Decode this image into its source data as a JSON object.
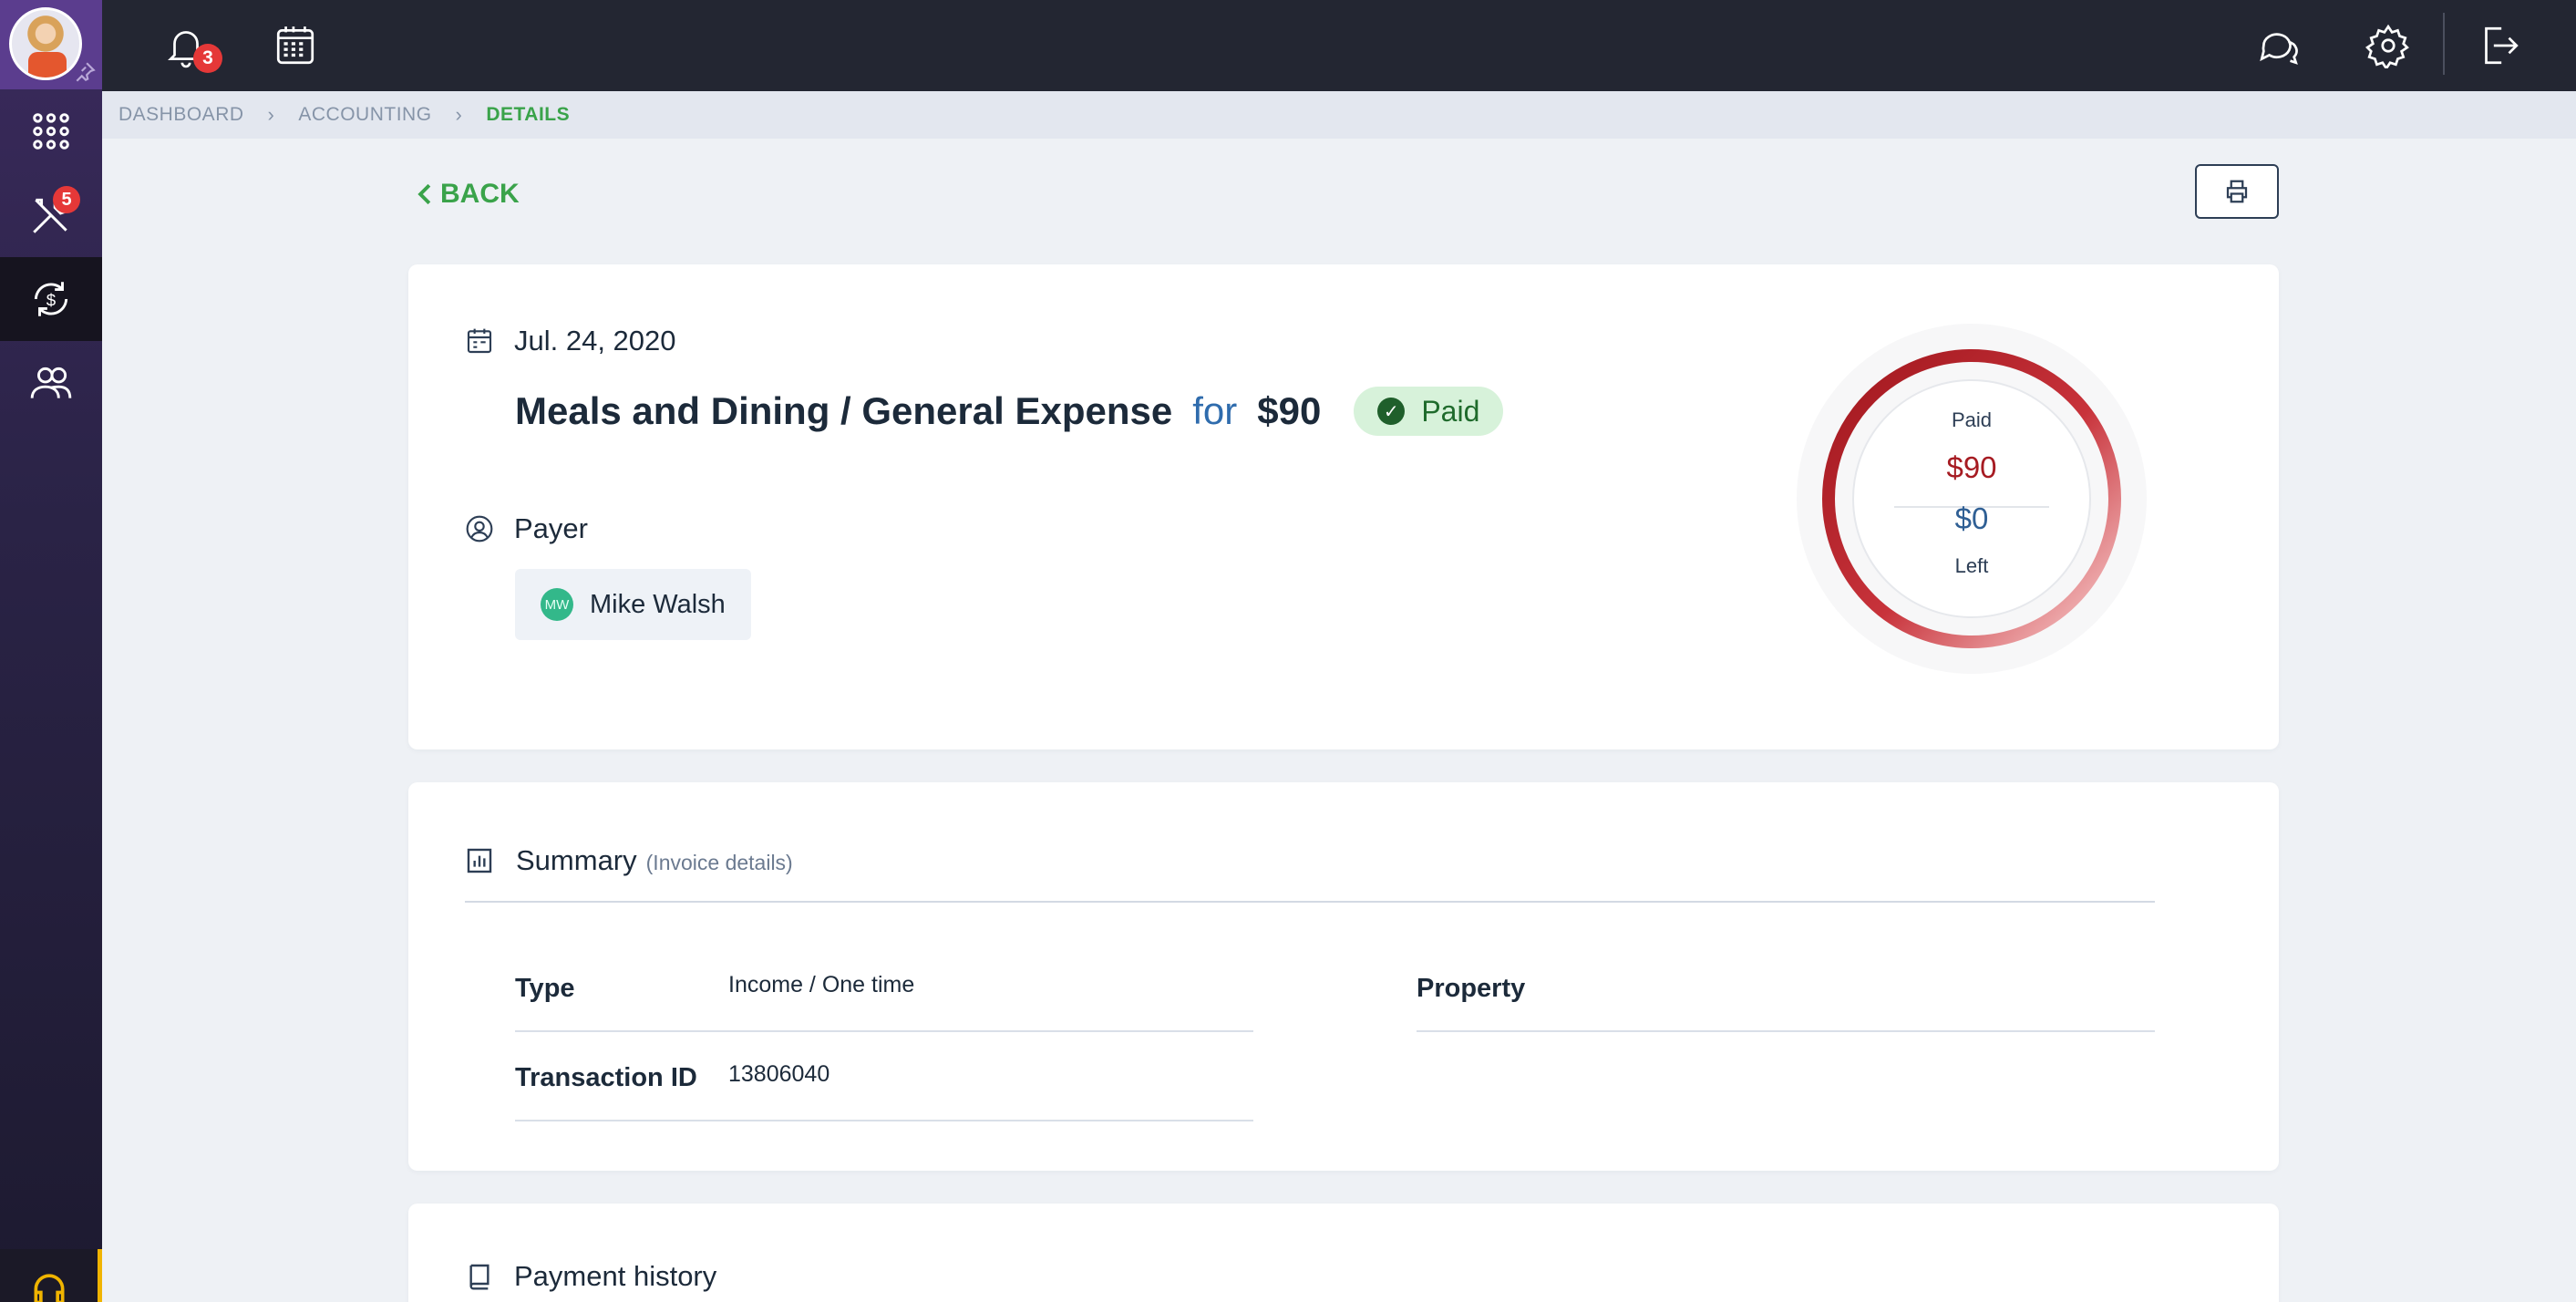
{
  "topbar": {
    "notifications_count": "3"
  },
  "sidebar": {
    "tools_badge": "5"
  },
  "breadcrumb": {
    "items": [
      "DASHBOARD",
      "ACCOUNTING",
      "DETAILS"
    ]
  },
  "back_label": "BACK",
  "transaction": {
    "date": "Jul. 24, 2020",
    "category": "Meals and Dining / General Expense",
    "for_word": "for",
    "amount": "$90",
    "status": "Paid",
    "payer_label": "Payer",
    "payer_initials": "MW",
    "payer_name": "Mike Walsh"
  },
  "gauge": {
    "paid_label": "Paid",
    "paid_amount": "$90",
    "left_amount": "$0",
    "left_label": "Left",
    "paid_fraction": 1.0,
    "colors": {
      "ring": "#a61b22",
      "ring_light": "#f4c6c6"
    }
  },
  "summary": {
    "title": "Summary",
    "subtitle": "(Invoice details)",
    "type_label": "Type",
    "type_value": "Income / One time",
    "txn_label": "Transaction ID",
    "txn_value": "13806040",
    "property_label": "Property"
  },
  "payment_history": {
    "title": "Payment history"
  },
  "colors": {
    "accent_green": "#3aa34a",
    "link_blue": "#2f6cad"
  }
}
